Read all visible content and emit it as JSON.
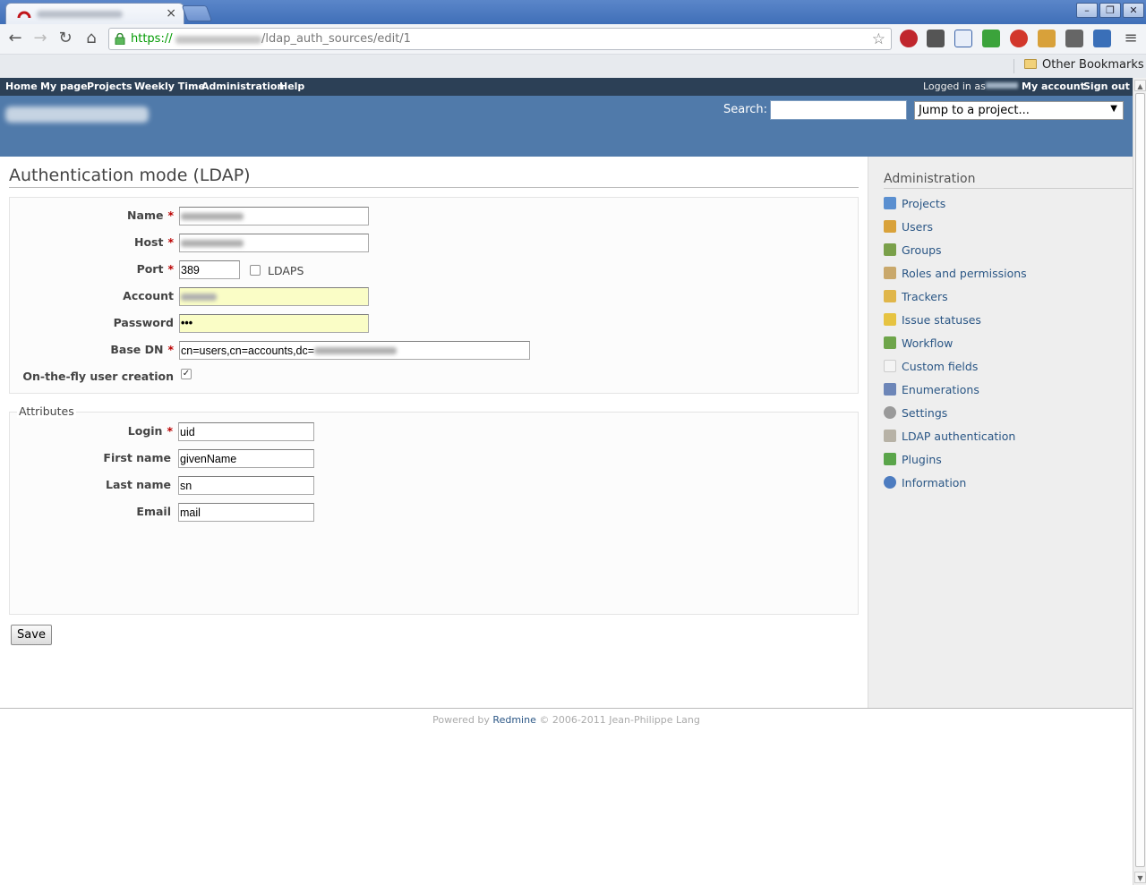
{
  "browser": {
    "url_scheme": "https://",
    "url_path": "/ldap_auth_sources/edit/1",
    "other_bookmarks": "Other Bookmarks",
    "win_minimize": "–",
    "win_restore": "❐",
    "win_close": "✕"
  },
  "top_menu": {
    "items": [
      "Home",
      "My page",
      "Projects",
      "Weekly Time",
      "Administration",
      "Help"
    ],
    "logged_in_prefix": "Logged in as",
    "my_account": "My account",
    "sign_out": "Sign out"
  },
  "header": {
    "search_label": "Search:",
    "search_value": "",
    "jump_label": "Jump to a project..."
  },
  "page": {
    "title": "Authentication mode (LDAP)"
  },
  "form": {
    "name_label": "Name",
    "host_label": "Host",
    "port_label": "Port",
    "port_value": "389",
    "ldaps_label": "LDAPS",
    "ldaps_checked": false,
    "account_label": "Account",
    "password_label": "Password",
    "password_value": "•••",
    "base_dn_label": "Base DN",
    "base_dn_value": "cn=users,cn=accounts,dc=",
    "onthefly_label": "On-the-fly user creation",
    "onthefly_checked": true,
    "required_mark": "*"
  },
  "attributes": {
    "legend": "Attributes",
    "login_label": "Login",
    "login_value": "uid",
    "firstname_label": "First name",
    "firstname_value": "givenName",
    "lastname_label": "Last name",
    "lastname_value": "sn",
    "email_label": "Email",
    "email_value": "mail"
  },
  "save_label": "Save",
  "sidebar": {
    "title": "Administration",
    "items": [
      {
        "label": "Projects",
        "icon": "projects-icon"
      },
      {
        "label": "Users",
        "icon": "user-icon"
      },
      {
        "label": "Groups",
        "icon": "group-icon"
      },
      {
        "label": "Roles and permissions",
        "icon": "roles-icon"
      },
      {
        "label": "Trackers",
        "icon": "tracker-icon"
      },
      {
        "label": "Issue statuses",
        "icon": "issue-status-icon"
      },
      {
        "label": "Workflow",
        "icon": "workflow-icon"
      },
      {
        "label": "Custom fields",
        "icon": "custom-fields-icon"
      },
      {
        "label": "Enumerations",
        "icon": "list-icon"
      },
      {
        "label": "Settings",
        "icon": "gear-icon"
      },
      {
        "label": "LDAP authentication",
        "icon": "server-auth-icon"
      },
      {
        "label": "Plugins",
        "icon": "plugin-icon"
      },
      {
        "label": "Information",
        "icon": "help-icon"
      }
    ]
  },
  "footer": {
    "powered_by": "Powered by",
    "redmine": "Redmine",
    "copyright": "© 2006-2011 Jean-Philippe Lang"
  }
}
